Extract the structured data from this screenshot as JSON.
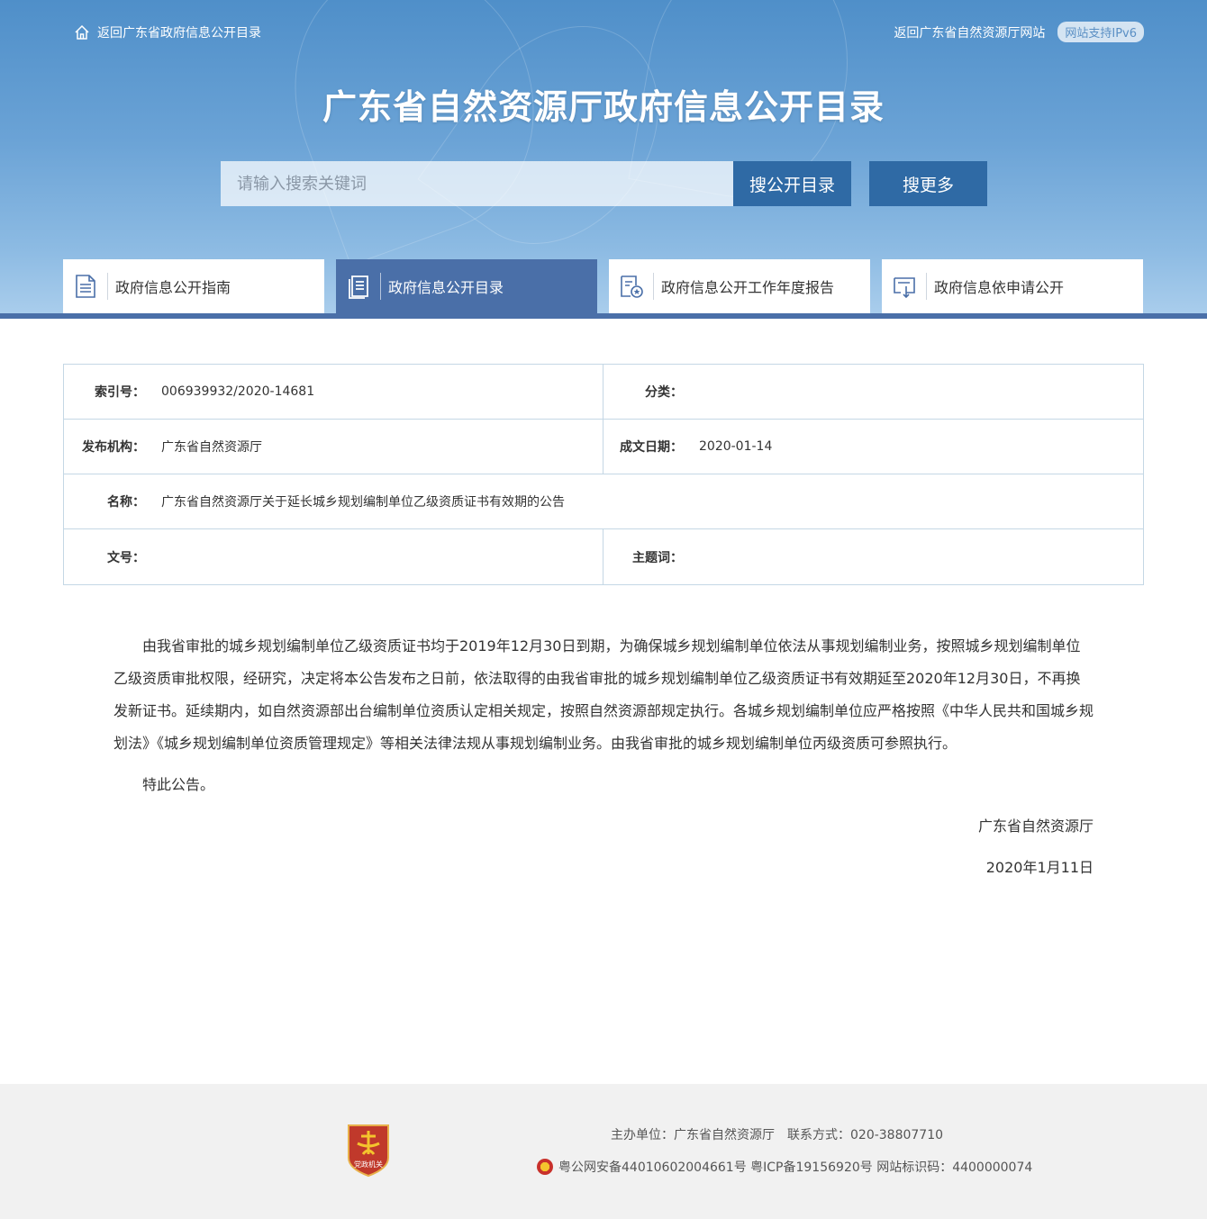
{
  "header": {
    "back_link": "返回广东省政府信息公开目录",
    "site_link": "返回广东省自然资源厅网站",
    "ipv6_badge": "网站支持IPv6",
    "title": "广东省自然资源厅政府信息公开目录",
    "search_placeholder": "请输入搜索关键词",
    "search_catalog_label": "搜公开目录",
    "search_more_label": "搜更多"
  },
  "tabs": [
    {
      "label": "政府信息公开指南",
      "icon": "document-icon",
      "active": false
    },
    {
      "label": "政府信息公开目录",
      "icon": "catalog-icon",
      "active": true
    },
    {
      "label": "政府信息公开工作年度报告",
      "icon": "report-icon",
      "active": false
    },
    {
      "label": "政府信息依申请公开",
      "icon": "apply-icon",
      "active": false
    }
  ],
  "info": {
    "index_label": "索引号：",
    "index_value": "006939932/2020-14681",
    "category_label": "分类：",
    "category_value": "",
    "publisher_label": "发布机构：",
    "publisher_value": "广东省自然资源厅",
    "date_label": "成文日期：",
    "date_value": "2020-01-14",
    "name_label": "名称：",
    "name_value": "广东省自然资源厅关于延长城乡规划编制单位乙级资质证书有效期的公告",
    "docno_label": "文号：",
    "docno_value": "",
    "keywords_label": "主题词：",
    "keywords_value": ""
  },
  "content": {
    "paragraph1": "由我省审批的城乡规划编制单位乙级资质证书均于2019年12月30日到期，为确保城乡规划编制单位依法从事规划编制业务，按照城乡规划编制单位乙级资质审批权限，经研究，决定将本公告发布之日前，依法取得的由我省审批的城乡规划编制单位乙级资质证书有效期延至2020年12月30日，不再换发新证书。延续期内，如自然资源部出台编制单位资质认定相关规定，按照自然资源部规定执行。各城乡规划编制单位应严格按照《中华人民共和国城乡规划法》《城乡规划编制单位资质管理规定》等相关法律法规从事规划编制业务。由我省审批的城乡规划编制单位丙级资质可参照执行。",
    "paragraph2": "特此公告。",
    "signature": "广东省自然资源厅",
    "sign_date": "2020年1月11日"
  },
  "footer": {
    "host_line": "主办单位：广东省自然资源厅　联系方式：020-38807710",
    "record_line": "粤公网安备44010602004661号 粤ICP备19156920号 网站标识码：4400000074",
    "emblem_text": "党政机关"
  }
}
